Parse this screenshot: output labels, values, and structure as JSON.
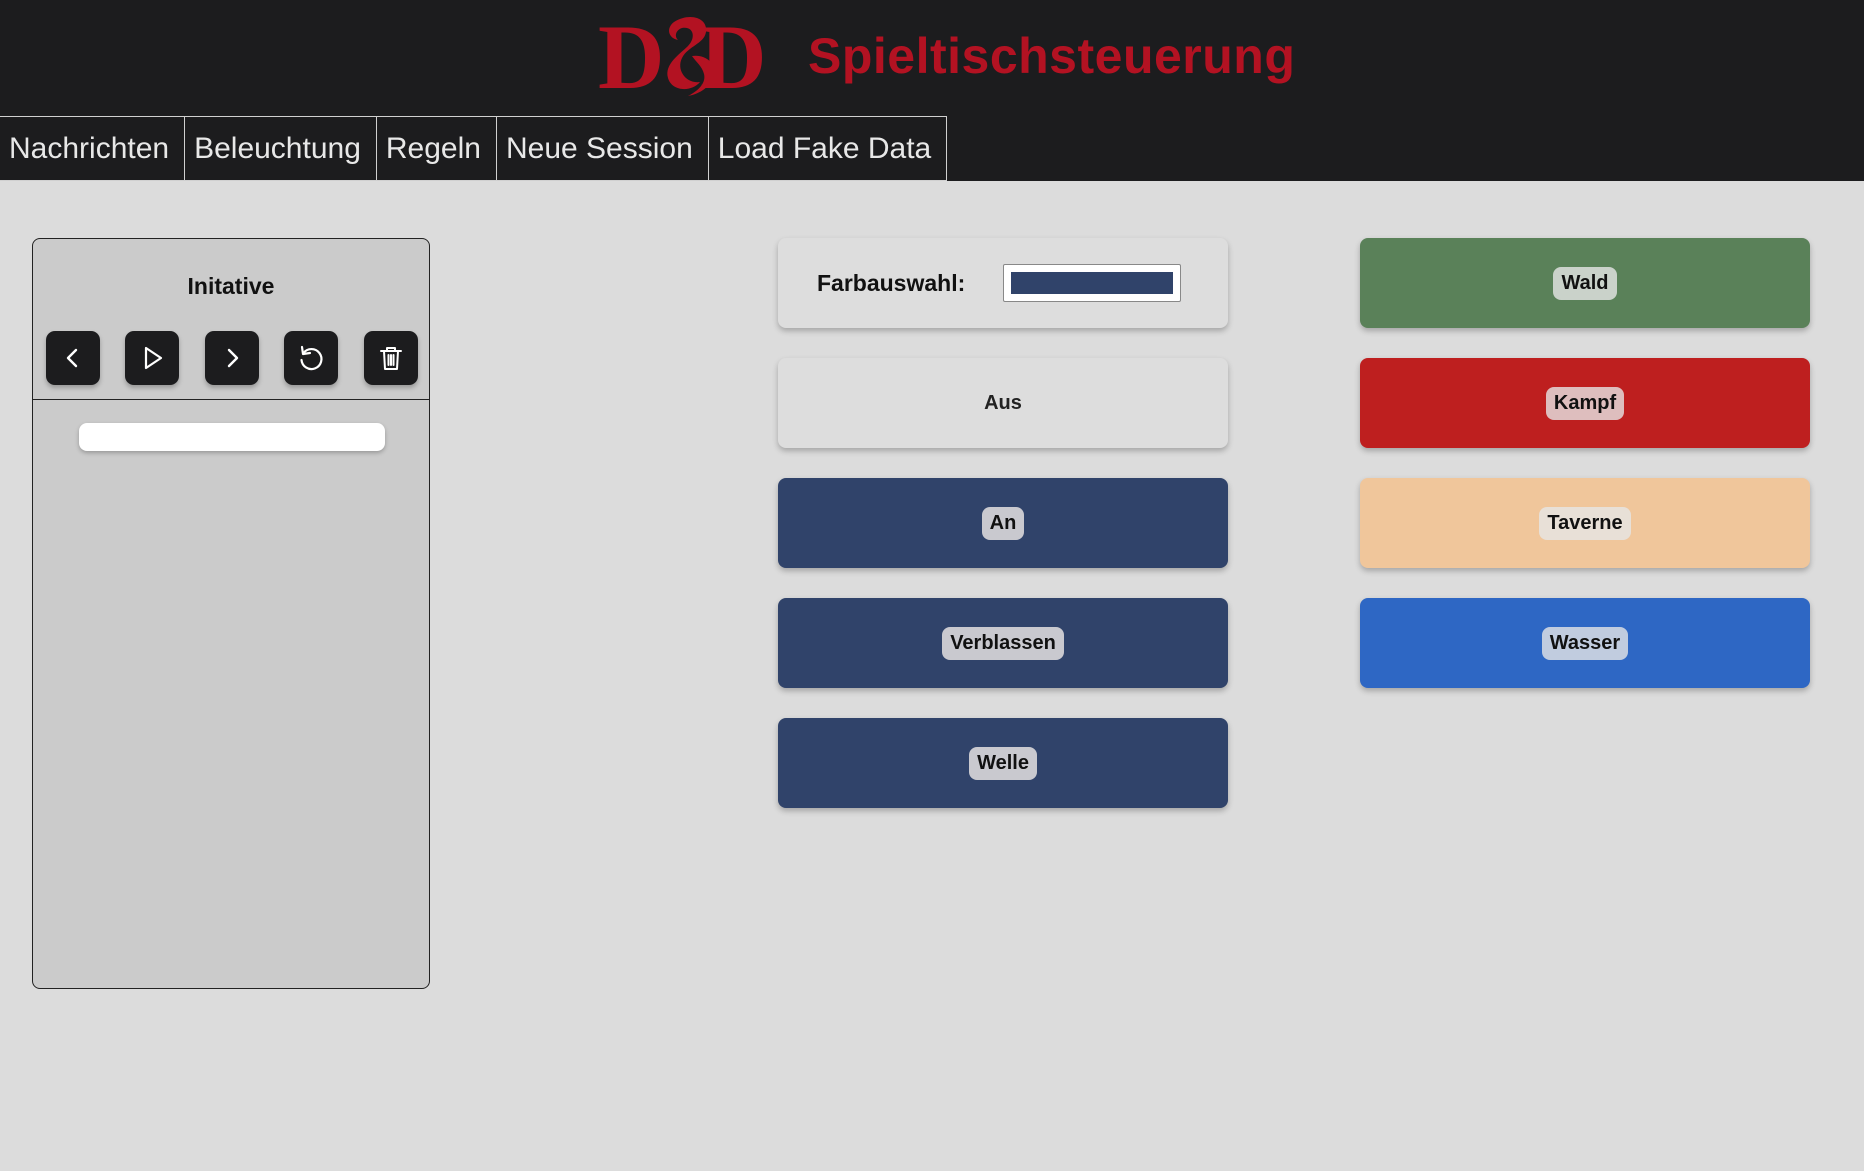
{
  "header": {
    "logo_text": "D&D",
    "title": "Spieltischsteuerung",
    "accent_color": "#b31222",
    "background": "#1c1c1e"
  },
  "nav": {
    "items": [
      "Nachrichten",
      "Beleuchtung",
      "Regeln",
      "Neue Session",
      "Load Fake Data"
    ]
  },
  "initiative": {
    "title": "Initative",
    "controls": {
      "previous": "chevron-left-icon",
      "start": "play-icon",
      "next": "chevron-right-icon",
      "reset": "reset-icon",
      "delete": "trash-icon"
    },
    "input_value": ""
  },
  "lighting": {
    "color_label": "Farbauswahl:",
    "selected_color": "#30436a",
    "buttons": [
      "Aus",
      "An",
      "Verblassen",
      "Welle"
    ]
  },
  "scenes": {
    "items": [
      {
        "label": "Wald",
        "color": "#5a8159"
      },
      {
        "label": "Kampf",
        "color": "#be1f1f"
      },
      {
        "label": "Taverne",
        "color": "#f0c69b"
      },
      {
        "label": "Wasser",
        "color": "#2e67c4"
      }
    ]
  }
}
